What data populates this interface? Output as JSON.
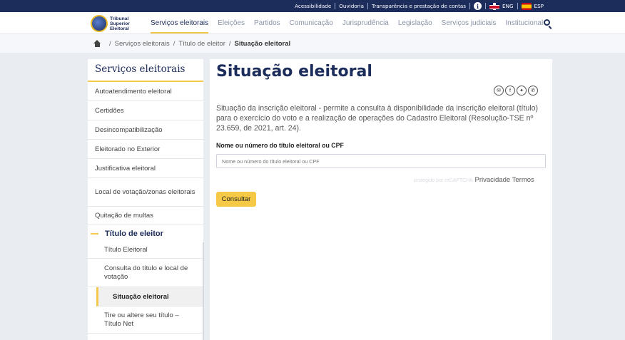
{
  "topbar": {
    "links": [
      "Acessibilidade",
      "Ouvidoria",
      "Transparência e prestação de contas"
    ],
    "info_glyph": "i",
    "lang_en": "ENG",
    "lang_es": "ESP"
  },
  "logo": {
    "line1": "Tribunal",
    "line2": "Superior",
    "line3": "Eleitoral"
  },
  "menu": [
    "Serviços eleitorais",
    "Eleições",
    "Partidos",
    "Comunicação",
    "Jurisprudência",
    "Legislação",
    "Serviços judiciais",
    "Institucional"
  ],
  "breadcrumb": {
    "item1": "Serviços eleitorais",
    "item2": "Título de eleitor",
    "current": "Situação eleitoral",
    "sep": "/"
  },
  "sidebar": {
    "title": "Serviços eleitorais",
    "items": [
      "Autoatendimento eleitoral",
      "Certidões",
      "Desincompatibilização",
      "Eleitorado no Exterior",
      "Justificativa eleitoral",
      "Local de votação/zonas eleitorais",
      "Quitação de multas"
    ],
    "group": "Título de eleitor",
    "sub_items": [
      "Título Eleitoral",
      "Consulta do título e local de votação",
      "Situação eleitoral",
      "Tire ou altere seu título – Título Net"
    ]
  },
  "main": {
    "title": "Situação eleitoral",
    "share_icons": [
      "✉",
      "f",
      "✦",
      "✆"
    ],
    "description": "Situação da inscrição eleitoral - permite a consulta à disponibilidade da inscrição eleitoral (título) para o exercício do voto e a realização de operações do Cadastro Eleitoral (Resolução-TSE nº 23.659, de 2021, art. 24).",
    "field_label": "Nome ou número do título eleitoral ou CPF",
    "field_placeholder": "Nome ou número do título eleitoral ou CPF",
    "recaptcha_text": "protegido por reCAPTCHA",
    "privacy": "Privacidade",
    "terms": "Termos",
    "submit": "Consultar"
  },
  "colors": {
    "navy": "#1c2c5b",
    "accent": "#f2c94c",
    "button": "#f5c945"
  }
}
